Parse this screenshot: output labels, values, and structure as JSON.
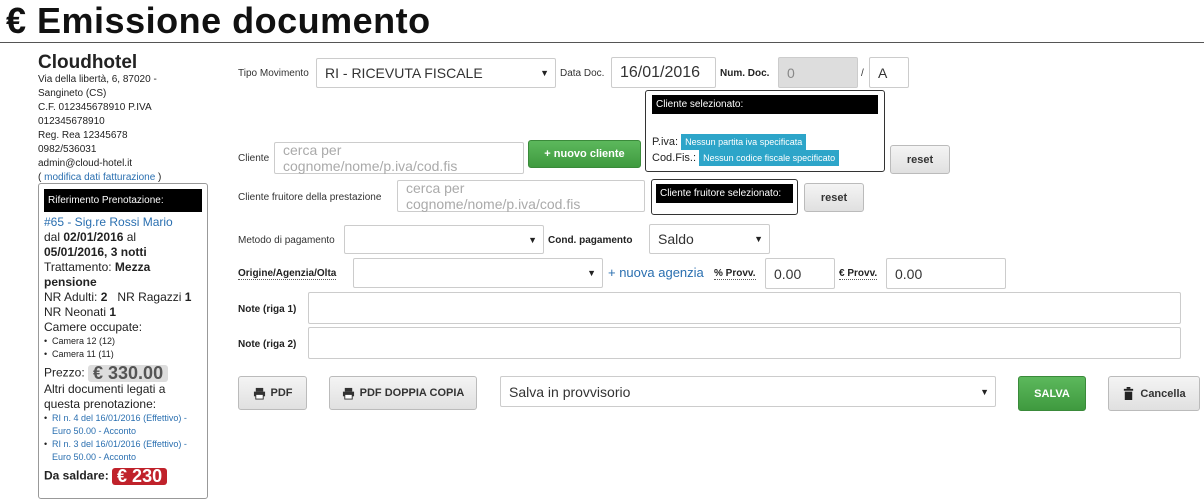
{
  "page": {
    "title": "€ Emissione documento"
  },
  "company": {
    "name": "Cloudhotel",
    "address1": "Via della libertà, 6, 87020 -",
    "address2": "Sangineto (CS)",
    "vat": "C.F. 012345678910 P.IVA",
    "vat2": "012345678910",
    "rea": "Reg. Rea 12345678",
    "phone": "0982/536031",
    "email": "admin@cloud-hotel.it",
    "edit_open": "( ",
    "edit_link": "modifica dati fatturazione",
    "edit_close": " )"
  },
  "booking": {
    "header": "Riferimento Prenotazione:",
    "ref_link": "#65 - Sig.re Rossi Mario",
    "from_label": "dal ",
    "from_date": "02/01/2016",
    "to_label": " al",
    "to_date": "05/01/2016, 3 notti",
    "treatment_label": "Trattamento: ",
    "treatment_value": "Mezza pensione",
    "adults_label": "NR Adulti: ",
    "adults_value": "2",
    "kids_label": "NR Ragazzi ",
    "kids_value": "1",
    "infants_label": "NR Neonati ",
    "infants_value": "1",
    "rooms_label": "Camere occupate:",
    "rooms": [
      "Camera 12 (12)",
      "Camera 11 (11)"
    ],
    "price_label": "Prezzo: ",
    "price_value": "€ 330.00",
    "other_docs_label": "Altri documenti legati a questa prenotazione:",
    "other_docs": [
      "RI n. 4 del 16/01/2016 (Effettivo) - Euro 50.00 - Acconto",
      "RI n. 3 del 16/01/2016 (Effettivo) - Euro 50.00 - Acconto"
    ],
    "due_label": "Da saldare: ",
    "due_value": "€ 230"
  },
  "form": {
    "tipo_movimento_label": "Tipo Movimento",
    "tipo_movimento_value": "RI - RICEVUTA FISCALE",
    "data_doc_label": "Data Doc.",
    "data_doc_value": "16/01/2016",
    "num_doc_label": "Num. Doc.",
    "num_doc_value": "0",
    "num_sep": "/",
    "num_series": "A",
    "cliente_label": "Cliente",
    "cliente_placeholder": "cerca per cognome/nome/p.iva/cod.fis",
    "nuovo_cliente": "+ nuovo cliente",
    "cliente_box_header": "Cliente selezionato:",
    "piva_label": "P.iva: ",
    "piva_value": "Nessun partita iva specificata",
    "codfis_label": "Cod.Fis.: ",
    "codfis_value": "Nessun codice fiscale specificato",
    "reset1": "reset",
    "fruitore_label": "Cliente fruitore della prestazione",
    "fruitore_placeholder": "cerca per cognome/nome/p.iva/cod.fis",
    "fruitore_box_header": "Cliente fruitore selezionato:",
    "reset2": "reset",
    "metodo_label": "Metodo di pagamento",
    "metodo_value": "",
    "cond_label": "Cond. pagamento",
    "cond_value": "Saldo",
    "origine_label": "Origine/Agenzia/Olta",
    "origine_value": "",
    "nuova_agenzia": "+ nuova agenzia",
    "provv_pct_label": "% Provv.",
    "provv_pct_value": "0.00",
    "provv_eur_label": "€ Provv.",
    "provv_eur_value": "0.00",
    "note1_label": "Note (riga 1)",
    "note1_value": "",
    "note2_label": "Note (riga 2)",
    "note2_value": ""
  },
  "actions": {
    "pdf": "PDF",
    "pdf_double": "PDF DOPPIA COPIA",
    "save_mode": "Salva in provvisorio",
    "save": "SALVA",
    "cancel": "Cancella"
  }
}
